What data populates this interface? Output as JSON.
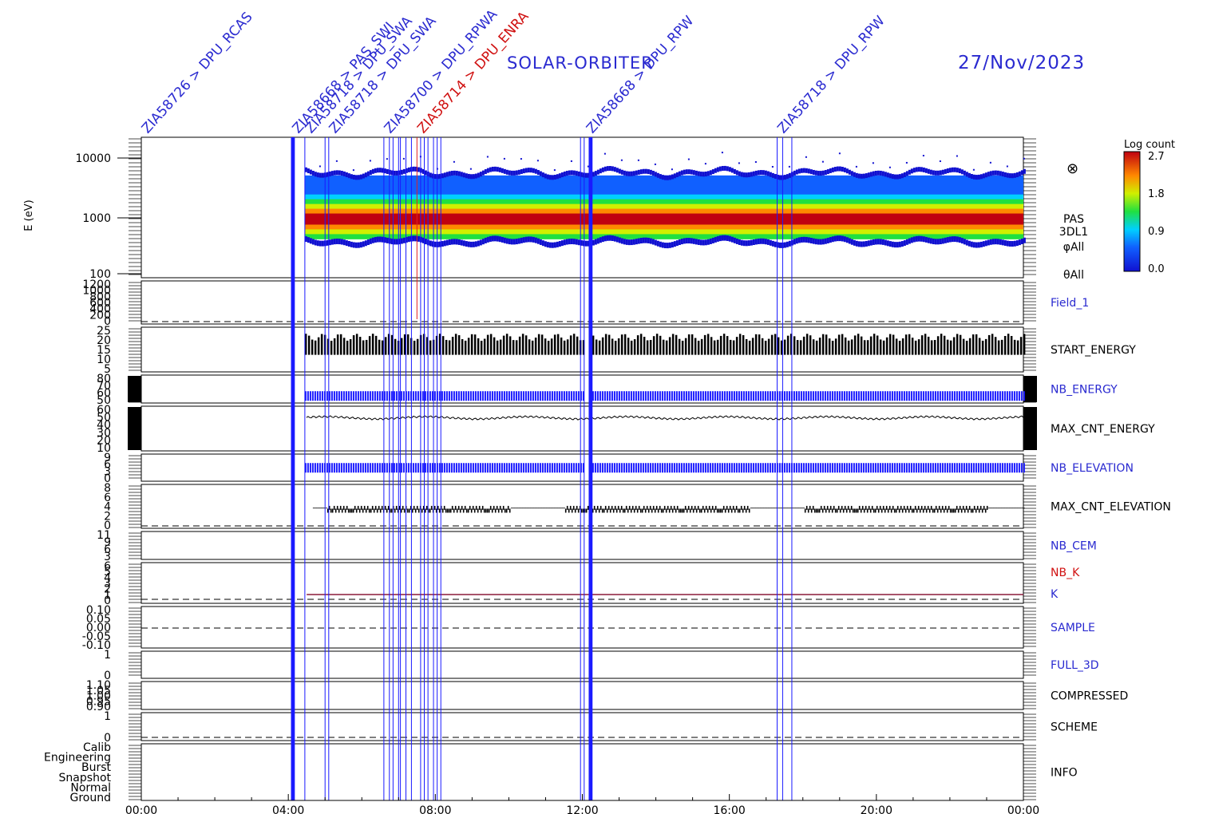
{
  "header": {
    "title": "SOLAR-ORBITER",
    "date": "27/Nov/2023"
  },
  "colors": {
    "axis": "#000000",
    "marker_blue": "#1a1aff",
    "marker_red": "#e02020",
    "label_blue": "#2a2ad0",
    "label_red": "#d01010",
    "plot_black": "#000000",
    "plot_blue": "#1a1aff",
    "k_line": "#8b1a3a"
  },
  "colorbar": {
    "label": "Log count",
    "ticks": [
      "2.7",
      "1.8",
      "0.9",
      "0.0"
    ]
  },
  "x_axis": {
    "ticks": [
      "00:00",
      "04:00",
      "08:00",
      "12:00",
      "16:00",
      "20:00",
      "00:00"
    ]
  },
  "top_markers": {
    "labels": [
      {
        "t": 0.0,
        "text": "ZIA58726 > DPU_RCAS",
        "color": "blue"
      },
      {
        "t": 4.1,
        "text": "ZIA58668 > PAS_SWI",
        "color": "blue"
      },
      {
        "t": 4.45,
        "text": "ZIA58718 > DPU_SWA",
        "color": "blue"
      },
      {
        "t": 5.1,
        "text": "ZIA58718 > DPU_SWA",
        "color": "blue"
      },
      {
        "t": 6.6,
        "text": "ZIA58700 > DPU_RPWA",
        "color": "blue"
      },
      {
        "t": 7.5,
        "text": "ZIA58714 > DPU_ENRA",
        "color": "red"
      },
      {
        "t": 12.1,
        "text": "ZIA58668 > DPU_RPW",
        "color": "blue"
      },
      {
        "t": 17.3,
        "text": "ZIA58718 > DPU_RPW",
        "color": "blue"
      }
    ],
    "blue_lines_hours": [
      4.1,
      4.15,
      4.45,
      5.0,
      5.1,
      6.6,
      6.75,
      6.85,
      7.0,
      7.05,
      7.2,
      7.35,
      7.6,
      7.7,
      7.8,
      7.95,
      8.05,
      8.15,
      11.95,
      12.05,
      12.2,
      12.25,
      17.3,
      17.45,
      17.7
    ],
    "red_lines_hours": [
      7.5
    ]
  },
  "panels": [
    {
      "id": "spectrogram",
      "right_label": "PAS",
      "right_label2": "3DL1",
      "right_label3": "φAll",
      "right_label4": "θAll",
      "label_color": "black",
      "ylabel": "E (eV)"
    },
    {
      "id": "field1",
      "right_label": "Field_1",
      "label_color": "blue",
      "ticks": [
        "1200",
        "1000",
        "800",
        "600",
        "400",
        "200",
        "0"
      ]
    },
    {
      "id": "start_energy",
      "right_label": "START_ENERGY",
      "label_color": "black",
      "ticks": [
        "25",
        "20",
        "15",
        "10",
        "5"
      ]
    },
    {
      "id": "nb_energy",
      "right_label": "NB_ENERGY",
      "label_color": "blue",
      "ticks": [
        "80",
        "70",
        "60",
        "50"
      ]
    },
    {
      "id": "max_cnt_energy",
      "right_label": "MAX_CNT_ENERGY",
      "label_color": "black",
      "ticks": [
        "60",
        "50",
        "40",
        "30",
        "20",
        "10"
      ]
    },
    {
      "id": "nb_elevation",
      "right_label": "NB_ELEVATION",
      "label_color": "blue",
      "ticks": [
        "9",
        "6",
        "3",
        "0"
      ]
    },
    {
      "id": "max_cnt_elevation",
      "right_label": "MAX_CNT_ELEVATION",
      "label_color": "black",
      "ticks": [
        "8",
        "6",
        "4",
        "2",
        "0"
      ]
    },
    {
      "id": "nb_cem",
      "right_label": "NB_CEM",
      "label_color": "blue",
      "ticks": [
        "11",
        "9",
        "6",
        "3"
      ]
    },
    {
      "id": "nb_k",
      "right_label": "NB_K",
      "right_label2": "K",
      "label_color": "red",
      "label2_color": "blue",
      "ticks": [
        "6",
        "5",
        "4",
        "3",
        "2",
        "1",
        "0"
      ]
    },
    {
      "id": "sample",
      "right_label": "SAMPLE",
      "label_color": "blue",
      "ticks": [
        "0.10",
        "0.05",
        "0.00",
        "-0.05",
        "-0.10"
      ]
    },
    {
      "id": "full_3d",
      "right_label": "FULL_3D",
      "label_color": "blue",
      "ticks": [
        "1",
        "0"
      ]
    },
    {
      "id": "compressed",
      "right_label": "COMPRESSED",
      "label_color": "black",
      "ticks": [
        "1.10",
        "1.05",
        "1.00",
        "0.95",
        "0.90"
      ]
    },
    {
      "id": "scheme",
      "right_label": "SCHEME",
      "label_color": "black",
      "ticks": [
        "1",
        "0"
      ]
    },
    {
      "id": "info",
      "right_label": "INFO",
      "label_color": "black",
      "ticks": [
        "Calib",
        "Engineering",
        "Burst",
        "Snapshot",
        "Normal",
        "Ground"
      ]
    }
  ],
  "chart_data": {
    "type": "heatmap",
    "title": "SOLAR-ORBITER",
    "xlabel": "",
    "ylabel": "E (eV)",
    "x_range_hours": [
      0,
      24
    ],
    "data_start_hour": 4.45,
    "y_log": true,
    "ylim": [
      100,
      10000
    ],
    "y_ticks": [
      "10000",
      "1000",
      "100"
    ],
    "colorbar_range": [
      0.0,
      2.7
    ],
    "peak_energy_eV": 900,
    "band_low_eV": 400,
    "band_high_eV": 5000,
    "max_cnt_energy_level": 49,
    "start_energy_range": [
      12,
      22
    ],
    "nb_energy_level": 57,
    "nb_elevation_level": 5,
    "max_cnt_elevation_level": 3.5,
    "k_level": 0.8
  }
}
